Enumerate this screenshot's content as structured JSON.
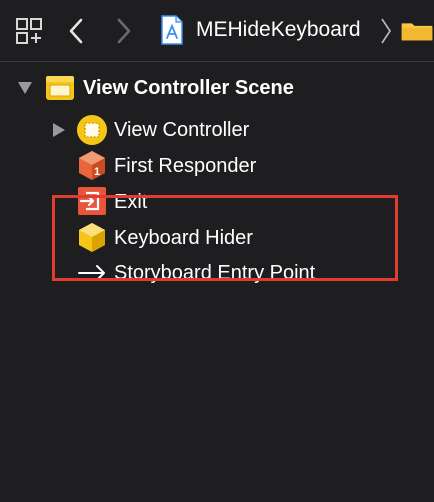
{
  "toolbar": {
    "breadcrumb_file": "MEHideKeyboard",
    "icons": [
      "related-items-grid-icon",
      "back-chevron-icon",
      "forward-chevron-icon",
      "storyboard-file-icon",
      "breadcrumb-separator-icon",
      "folder-icon"
    ]
  },
  "outline": {
    "scene": {
      "label": "View Controller Scene",
      "expanded": true,
      "icon": "scene-icon"
    },
    "items": [
      {
        "label": "View Controller",
        "icon": "view-controller-icon",
        "collapsible": true
      },
      {
        "label": "First Responder",
        "icon": "first-responder-icon",
        "collapsible": false
      },
      {
        "label": "Exit",
        "icon": "exit-icon",
        "collapsible": false
      },
      {
        "label": "Keyboard Hider",
        "icon": "object-cube-icon",
        "collapsible": false
      },
      {
        "label": "Storyboard Entry Point",
        "icon": "entry-arrow-icon",
        "collapsible": false
      }
    ]
  },
  "colors": {
    "background": "#1e1e20",
    "highlight": "#e23b30",
    "scene_yellow": "#f5c518",
    "responder_orange": "#e8663a",
    "exit_red": "#e8553a",
    "folder_yellow": "#f7c948",
    "file_blue": "#3b8ff0"
  }
}
